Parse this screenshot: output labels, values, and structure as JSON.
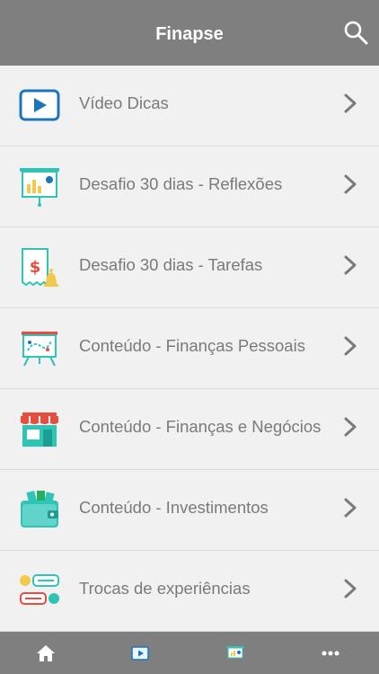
{
  "header": {
    "title": "Finapse",
    "search_icon": "search-icon"
  },
  "menu": {
    "items": [
      {
        "label": "Vídeo Dicas",
        "icon": "video-play-icon"
      },
      {
        "label": "Desafio 30 dias - Reflexões",
        "icon": "presentation-chart-icon"
      },
      {
        "label": "Desafio 30 dias - Tarefas",
        "icon": "receipt-bell-icon"
      },
      {
        "label": "Conteúdo - Finanças Pessoais",
        "icon": "whiteboard-icon"
      },
      {
        "label": "Conteúdo - Finanças e Negócios",
        "icon": "storefront-icon"
      },
      {
        "label": "Conteúdo - Investimentos",
        "icon": "wallet-money-icon"
      },
      {
        "label": "Trocas de experiências",
        "icon": "chat-exchange-icon"
      }
    ]
  },
  "tabbar": {
    "items": [
      {
        "icon": "home-icon"
      },
      {
        "icon": "video-icon"
      },
      {
        "icon": "presentation-icon"
      },
      {
        "icon": "more-icon"
      }
    ]
  },
  "colors": {
    "bar": "#7f7f7f",
    "background": "#f1f1f1",
    "label_text": "#7a7a7a",
    "icon_accent": "#2ec4b6",
    "icon_blue": "#1b75bb"
  }
}
